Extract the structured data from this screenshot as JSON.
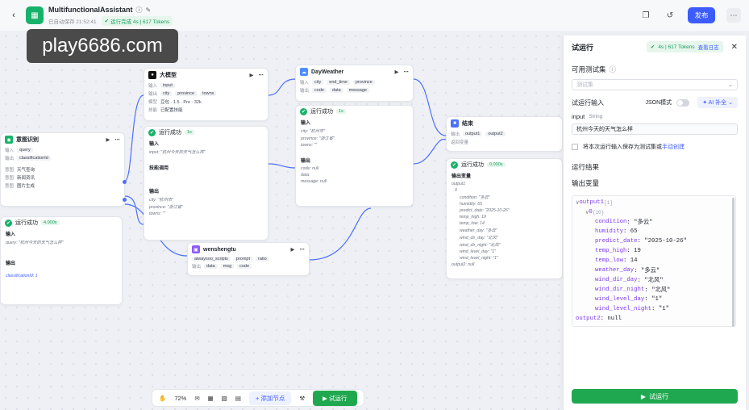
{
  "topbar": {
    "title": "MultifunctionalAssistant",
    "autosave": "已自动保存 21:52:41",
    "run_status": "运行完成 4s | 617 Tokens",
    "publish": "发布"
  },
  "watermark": "play6686.com",
  "nodes": {
    "intent": {
      "title": "意图识别",
      "in_label": "输入",
      "in_val": "query",
      "out_label": "输出",
      "out_val": "classificationId",
      "intent_label": "意图",
      "opts": [
        "天气查询",
        "新闻资讯",
        "图片生成"
      ],
      "result": "运行成功",
      "time": "4.000s",
      "r_in": "输入",
      "query": "query: \"杭州今天的天气怎么样\"",
      "r_out": "输出",
      "cls": "classificationId: 1"
    },
    "llm": {
      "title": "大模型",
      "in_label": "输入",
      "in_val": "input",
      "out_label": "输出",
      "outs": [
        "city",
        "province",
        "towns"
      ],
      "model_label": "模型",
      "model_val": "豆包 · 1.5 · Pro · 32k",
      "skill_label": "技能",
      "skill_val": "已配置技能",
      "result": "运行成功",
      "time": "1s",
      "r_in": "输入",
      "r_in_val": "input: \"杭州今天的天气怎么样\"",
      "skill": "技能调用",
      "r_out": "输出",
      "city": "city: \"杭州市\"",
      "prov": "province: \"浙江省\"",
      "towns": "towns: \"\""
    },
    "weather": {
      "title": "DayWeather",
      "in_label": "输入",
      "ins": [
        "city",
        "end_time",
        "province"
      ],
      "out_label": "输出",
      "outs": [
        "code",
        "data",
        "message"
      ],
      "result": "运行成功",
      "time": "1s",
      "r_in": "输入",
      "city": "city: \"杭州市\"",
      "prov": "province: \"浙江省\"",
      "towns": "towns: \"\"",
      "r_out": "输出",
      "code": "code: null",
      "data": "data: ",
      "msg": "message: null"
    },
    "wensheng": {
      "title": "wenshengtu",
      "ins": [
        "aiwaysoo_scripts",
        "prompt",
        "ratio"
      ],
      "out_label": "输出",
      "outs": [
        "data",
        "msg",
        "code"
      ]
    },
    "end": {
      "title": "结束",
      "in_label": "输出",
      "outs": [
        "output1",
        "output2"
      ],
      "ret_label": "返回变量",
      "result": "运行成功",
      "time": "0.000s",
      "var_label": "输出变量",
      "lines": [
        "output1",
        "0",
        "condition: \"多云\"",
        "humidity: 65",
        "predict_date: \"2025-10-26\"",
        "temp_high: 19",
        "temp_low: 14",
        "weather_day: \"多云\"",
        "wind_dir_day: \"北风\"",
        "wind_dir_night: \"北风\"",
        "wind_level_day: \"1\"",
        "wind_level_night: \"1\"",
        "output2: null"
      ]
    }
  },
  "zoombar": {
    "zoom": "72%",
    "add_node": "添加节点",
    "run": "试运行"
  },
  "panel": {
    "title": "试运行",
    "tokens": "4s | 617 Tokens",
    "view_log": "查看日志",
    "testset_label": "可用测试集",
    "testset_placeholder": "测试集",
    "input_label": "试运行输入",
    "json_mode": "JSON模式",
    "ai_fill": "AI 补全",
    "field_name": "input",
    "field_type": "String",
    "field_value": "杭州今天的天气怎么样",
    "save_text": "将本次运行输入保存为测试集或",
    "save_link": "手动创建",
    "result_label": "运行结果",
    "output_var_label": "输出变量",
    "tree": [
      {
        "k": "output1",
        "v": "",
        "tag": "[1]",
        "lvl": 0
      },
      {
        "k": "0",
        "v": "",
        "tag": "{10}",
        "lvl": 1
      },
      {
        "k": "condition",
        "v": ": \"多云\"",
        "lvl": 2
      },
      {
        "k": "humidity",
        "v": ": 65",
        "lvl": 2
      },
      {
        "k": "predict_date",
        "v": ": \"2025-10-26\"",
        "lvl": 2
      },
      {
        "k": "temp_high",
        "v": ": 19",
        "lvl": 2
      },
      {
        "k": "temp_low",
        "v": ": 14",
        "lvl": 2
      },
      {
        "k": "weather_day",
        "v": ": \"多云\"",
        "lvl": 2
      },
      {
        "k": "wind_dir_day",
        "v": ": \"北风\"",
        "lvl": 2
      },
      {
        "k": "wind_dir_night",
        "v": ": \"北风\"",
        "lvl": 2
      },
      {
        "k": "wind_level_day",
        "v": ": \"1\"",
        "lvl": 2
      },
      {
        "k": "wind_level_night",
        "v": ": \"1\"",
        "lvl": 2
      },
      {
        "k": "output2",
        "v": ": null",
        "lvl": 0
      }
    ],
    "run_button": "试运行"
  }
}
